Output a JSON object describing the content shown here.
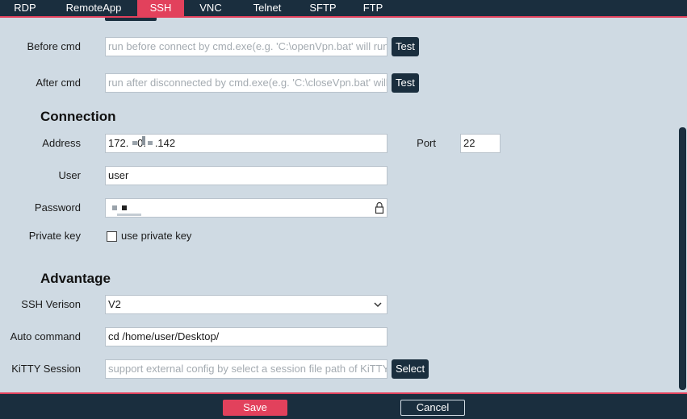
{
  "tabs": [
    {
      "label": "RDP"
    },
    {
      "label": "RemoteApp"
    },
    {
      "label": "SSH"
    },
    {
      "label": "VNC"
    },
    {
      "label": "Telnet"
    },
    {
      "label": "SFTP"
    },
    {
      "label": "FTP"
    }
  ],
  "active_tab": "SSH",
  "before_cmd": {
    "label": "Before cmd",
    "placeholder": "run before connect by cmd.exe(e.g. 'C:\\openVpn.bat' will run",
    "test_label": "Test"
  },
  "after_cmd": {
    "label": "After cmd",
    "placeholder": "run after disconnected by cmd.exe(e.g. 'C:\\closeVpn.bat' will",
    "test_label": "Test"
  },
  "connection": {
    "title": "Connection",
    "address_label": "Address",
    "address_value": "172.   0.   .142",
    "port_label": "Port",
    "port_value": "22",
    "user_label": "User",
    "user_value": "user",
    "password_label": "Password",
    "private_key_label": "Private key",
    "use_private_key_label": "use private key"
  },
  "advantage": {
    "title": "Advantage",
    "ssh_version_label": "SSH Verison",
    "ssh_version_value": "V2",
    "auto_command_label": "Auto command",
    "auto_command_value": "cd /home/user/Desktop/",
    "kitty_session_label": "KiTTY Session",
    "kitty_session_placeholder": "support external config by select a session file path of KiTTY",
    "select_label": "Select"
  },
  "footer": {
    "save_label": "Save",
    "cancel_label": "Cancel"
  },
  "colors": {
    "accent": "#e2415c",
    "dark": "#1a2e3e",
    "background": "#cfdae3"
  }
}
